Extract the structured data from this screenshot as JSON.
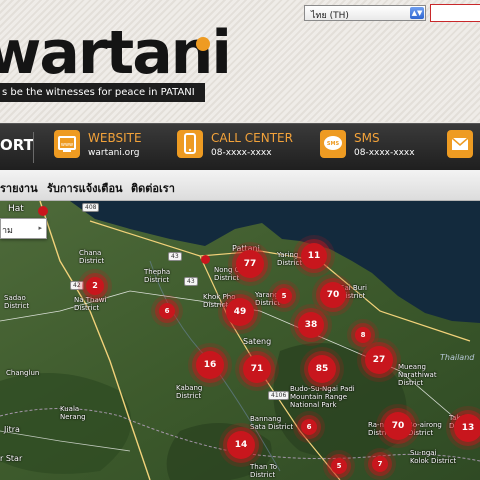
{
  "header": {
    "language_select": "ไทย (TH)",
    "language_arrow": "▲▼",
    "logo_text": "wartani",
    "tagline": "s be the witnesses for peace in PATANI"
  },
  "contact_bar": {
    "support_label": "ORT",
    "items": [
      {
        "title": "WEBSITE",
        "value": "wartani.org",
        "icon": "website-icon"
      },
      {
        "title": "CALL CENTER",
        "value": "08-xxxx-xxxx",
        "icon": "phone-icon"
      },
      {
        "title": "SMS",
        "value": "08-xxxx-xxxx",
        "icon": "sms-icon"
      },
      {
        "title": "",
        "value": "",
        "icon": "mail-icon"
      }
    ]
  },
  "nav": {
    "items": [
      "รายงาน",
      "รับการแจ้งเตือน",
      "ติดต่อเรา"
    ]
  },
  "map": {
    "control_label": "าม",
    "control_arrow": "▸",
    "places": {
      "hat": "Hat",
      "chana": "Chana\nDistrict",
      "thepha": "Thepha\nDistrict",
      "na_thawi": "Na Thawi\nDistrict",
      "sadao": "Sadao\nDistrict",
      "khok_pho": "Khok Pho\nDistrict",
      "nong_chik": "Nong Chik\nDistrict",
      "pattani": "Pattani",
      "yaring": "Yaring\nDistrict",
      "yarang": "Yarang\nDistrict",
      "sai_buri": "Sai Buri\nDistrict",
      "sateng": "Sateng",
      "changlun": "Changlun",
      "kabang": "Kabang\nDistrict",
      "budo": "Budo-Su-Ngai Padi\nMountain Range\nNational Park",
      "mueang_narathiwat": "Mueang\nNarathiwat\nDistrict",
      "thailand": "Thailand",
      "kuala_nerang": "Kuala\nNerang",
      "jitra": "Jitra",
      "bannang_sata": "Bannang\nSata District",
      "ra_ngae": "Ra-ngae\nDistrict",
      "tak_bai": "Tak Ba\nDistri",
      "airong": "Bo-airong\nDistrict",
      "su_ngai_kolok": "Su-ngai\nKolok District",
      "than_to": "Than To\nDistrict",
      "star": "r Star"
    },
    "roads": [
      "408",
      "43",
      "42",
      "4106",
      "43"
    ],
    "clusters": [
      77,
      11,
      2,
      5,
      70,
      6,
      49,
      38,
      8,
      16,
      71,
      85,
      27,
      14,
      6,
      70,
      13,
      5,
      7
    ]
  },
  "colors": {
    "accent_orange": "#ee9b22",
    "cluster_red": "#c8161d",
    "header_dark": "#1f1f1f"
  }
}
